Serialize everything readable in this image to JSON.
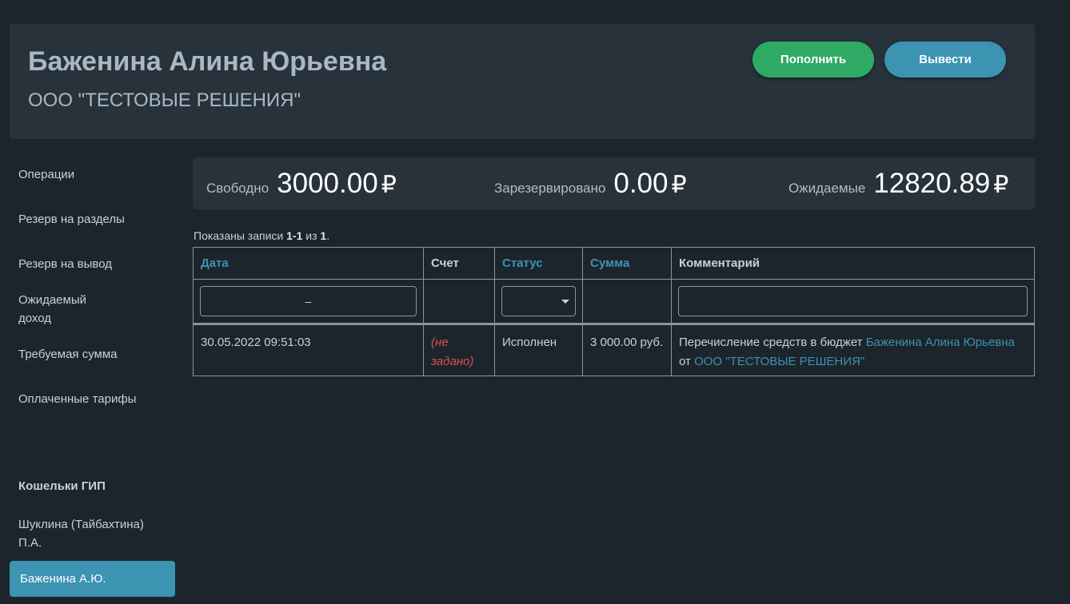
{
  "header": {
    "name": "Баженина Алина Юрьевна",
    "company": "ООО \"ТЕСТОВЫЕ РЕШЕНИЯ\"",
    "topup_label": "Пополнить",
    "withdraw_label": "Вывести"
  },
  "sidebar": {
    "items": [
      {
        "label": "Операции"
      },
      {
        "label": "Резерв на разделы"
      },
      {
        "label": "Резерв на вывод"
      },
      {
        "label": "Ожидаемый доход"
      },
      {
        "label": "Требуемая сумма"
      },
      {
        "label": "Оплаченные тарифы"
      }
    ],
    "wallets_heading": "Кошельки ГИП",
    "wallets": [
      {
        "label": "Шуклина (Тайбахтина) П.А."
      },
      {
        "label": "Баженина А.Ю.",
        "active": true
      }
    ]
  },
  "balance": {
    "free_label": "Свободно",
    "free_value": "3000.00",
    "reserved_label": "Зарезервировано",
    "reserved_value": "0.00",
    "expected_label": "Ожидаемые",
    "expected_value": "12820.89",
    "currency": "₽"
  },
  "summary": {
    "prefix": "Показаны записи ",
    "range": "1-1",
    "middle": " из ",
    "total": "1",
    "suffix": "."
  },
  "table": {
    "columns": [
      "Дата",
      "Счет",
      "Статус",
      "Сумма",
      "Комментарий"
    ],
    "date_filter_value": "–",
    "rows": [
      {
        "date": "30.05.2022 09:51:03",
        "account": "(не задано)",
        "status": "Исполнен",
        "amount": "3 000.00 руб.",
        "comment_prefix": "Перечисление средств в бюджет ",
        "comment_user": "Баженина Алина Юрьевна",
        "comment_middle": " от ",
        "comment_company": "ООО \"ТЕСТОВЫЕ РЕШЕНИЯ\""
      }
    ]
  },
  "colors": {
    "background": "#1c252c",
    "panel": "#27323b",
    "accent_blue": "#3c93b2",
    "accent_green": "#2eaa64",
    "error_red": "#d9534f"
  }
}
